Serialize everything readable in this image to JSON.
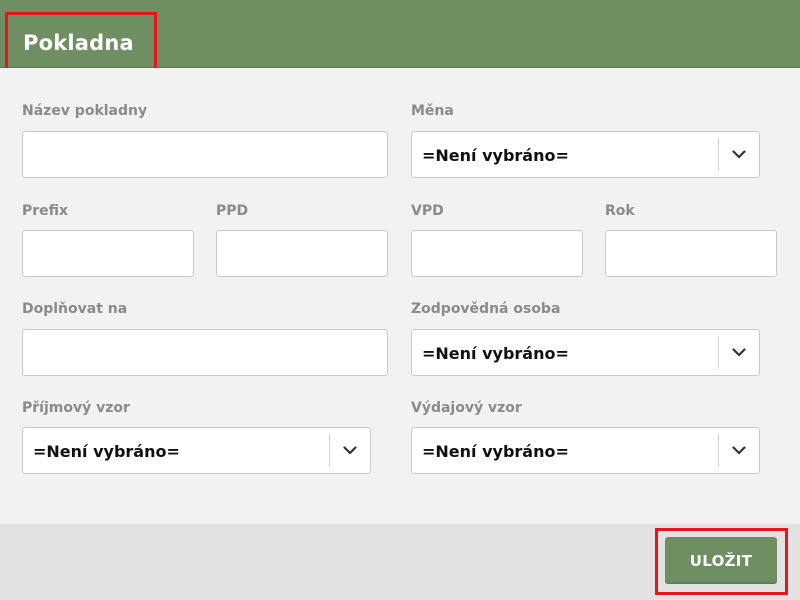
{
  "header": {
    "title": "Pokladna"
  },
  "form": {
    "nazev_pokladny": {
      "label": "Název pokladny",
      "value": ""
    },
    "mena": {
      "label": "Měna",
      "value": "=Není vybráno="
    },
    "prefix": {
      "label": "Prefix",
      "value": ""
    },
    "ppd": {
      "label": "PPD",
      "value": ""
    },
    "vpd": {
      "label": "VPD",
      "value": ""
    },
    "rok": {
      "label": "Rok",
      "value": ""
    },
    "doplnovat_na": {
      "label": "Doplňovat na",
      "value": ""
    },
    "zodpovedna_osoba": {
      "label": "Zodpovědná osoba",
      "value": "=Není vybráno="
    },
    "prijmovy_vzor": {
      "label": "Příjmový vzor",
      "value": "=Není vybráno="
    },
    "vydajovy_vzor": {
      "label": "Výdajový vzor",
      "value": "=Není vybráno="
    }
  },
  "footer": {
    "save_label": "ULOŽIT"
  },
  "colors": {
    "header_green": "#6f8f62",
    "highlight_red": "#e8141c"
  },
  "icons": {
    "select_arrow": "chevron-down-icon"
  }
}
